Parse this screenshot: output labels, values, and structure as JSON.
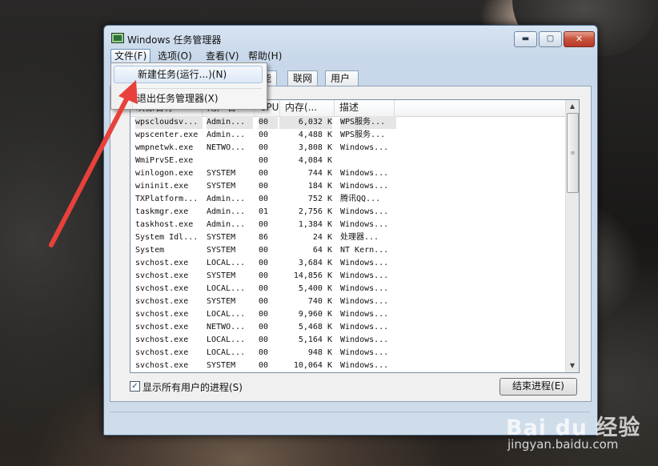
{
  "window": {
    "title": "Windows 任务管理器",
    "buttons": {
      "minimize": "▬",
      "maximize": "▢",
      "close": "✕"
    }
  },
  "menubar": [
    "文件(F)",
    "选项(O)",
    "查看(V)",
    "帮助(H)"
  ],
  "tabs": [
    "能",
    "联网",
    "用户"
  ],
  "file_menu": {
    "items": [
      "新建任务(运行...)(N)",
      "退出任务管理器(X)"
    ]
  },
  "columns": [
    "映像名称",
    "用户名",
    "CPU",
    "内存(...",
    "描述"
  ],
  "processes": [
    {
      "name": "wpscloudsv...",
      "user": "Admin...",
      "cpu": "00",
      "mem": "6,032 K",
      "desc": "WPS服务..."
    },
    {
      "name": "wpscenter.exe",
      "user": "Admin...",
      "cpu": "00",
      "mem": "4,488 K",
      "desc": "WPS服务..."
    },
    {
      "name": "wmpnetwk.exe",
      "user": "NETWO...",
      "cpu": "00",
      "mem": "3,808 K",
      "desc": "Windows..."
    },
    {
      "name": "WmiPrvSE.exe",
      "user": "",
      "cpu": "00",
      "mem": "4,084 K",
      "desc": ""
    },
    {
      "name": "winlogon.exe",
      "user": "SYSTEM",
      "cpu": "00",
      "mem": "744 K",
      "desc": "Windows..."
    },
    {
      "name": "wininit.exe",
      "user": "SYSTEM",
      "cpu": "00",
      "mem": "184 K",
      "desc": "Windows..."
    },
    {
      "name": "TXPlatform...",
      "user": "Admin...",
      "cpu": "00",
      "mem": "752 K",
      "desc": "腾讯QQ..."
    },
    {
      "name": "taskmgr.exe",
      "user": "Admin...",
      "cpu": "01",
      "mem": "2,756 K",
      "desc": "Windows..."
    },
    {
      "name": "taskhost.exe",
      "user": "Admin...",
      "cpu": "00",
      "mem": "1,384 K",
      "desc": "Windows..."
    },
    {
      "name": "System Idl...",
      "user": "SYSTEM",
      "cpu": "86",
      "mem": "24 K",
      "desc": "处理器..."
    },
    {
      "name": "System",
      "user": "SYSTEM",
      "cpu": "00",
      "mem": "64 K",
      "desc": "NT Kern..."
    },
    {
      "name": "svchost.exe",
      "user": "LOCAL...",
      "cpu": "00",
      "mem": "3,684 K",
      "desc": "Windows..."
    },
    {
      "name": "svchost.exe",
      "user": "SYSTEM",
      "cpu": "00",
      "mem": "14,856 K",
      "desc": "Windows..."
    },
    {
      "name": "svchost.exe",
      "user": "LOCAL...",
      "cpu": "00",
      "mem": "5,400 K",
      "desc": "Windows..."
    },
    {
      "name": "svchost.exe",
      "user": "SYSTEM",
      "cpu": "00",
      "mem": "740 K",
      "desc": "Windows..."
    },
    {
      "name": "svchost.exe",
      "user": "LOCAL...",
      "cpu": "00",
      "mem": "9,960 K",
      "desc": "Windows..."
    },
    {
      "name": "svchost.exe",
      "user": "NETWO...",
      "cpu": "00",
      "mem": "5,468 K",
      "desc": "Windows..."
    },
    {
      "name": "svchost.exe",
      "user": "LOCAL...",
      "cpu": "00",
      "mem": "5,164 K",
      "desc": "Windows..."
    },
    {
      "name": "svchost.exe",
      "user": "LOCAL...",
      "cpu": "00",
      "mem": "948 K",
      "desc": "Windows..."
    },
    {
      "name": "svchost.exe",
      "user": "SYSTEM",
      "cpu": "00",
      "mem": "10,064 K",
      "desc": "Windows..."
    }
  ],
  "show_all_users": {
    "label": "显示所有用户的进程(S)",
    "checked": "✓"
  },
  "end_process_button": "结束进程(E)",
  "watermark": {
    "logo": "Bai du 经验",
    "url": "jingyan.baidu.com"
  },
  "annotation": {
    "arrow_color": "#e8413b"
  }
}
